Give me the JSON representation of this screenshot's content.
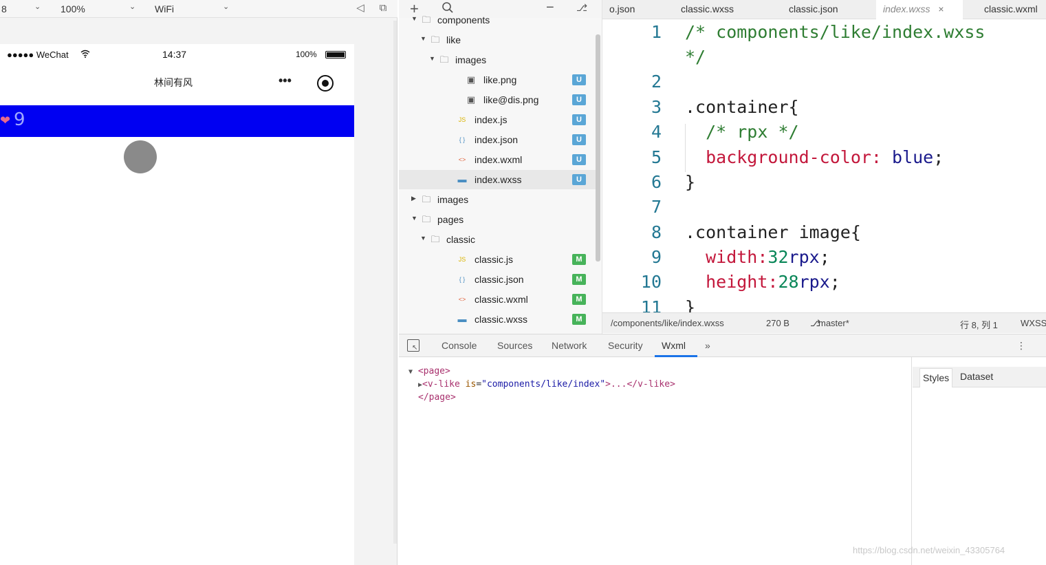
{
  "simulator": {
    "toolbar": {
      "device_value": "8",
      "zoom_value": "100%",
      "network_value": "WiFi"
    },
    "statusbar": {
      "signal": "●●●●● WeChat",
      "time": "14:37",
      "battery_percent": "100%"
    },
    "navbar": {
      "title": "林间有风",
      "more_icon": "•••",
      "record_icon": "◉"
    },
    "like_component": {
      "heart": "❤",
      "count": "9",
      "bar_color": "#0000f2"
    }
  },
  "file_tree": {
    "rows": [
      {
        "label": "components",
        "type": "folder",
        "depth": 1,
        "expanded": true,
        "badge": ""
      },
      {
        "label": "like",
        "type": "folder",
        "depth": 2,
        "expanded": true,
        "badge": ""
      },
      {
        "label": "images",
        "type": "folder",
        "depth": 3,
        "expanded": true,
        "badge": ""
      },
      {
        "label": "like.png",
        "type": "image",
        "depth": 4,
        "badge": "U"
      },
      {
        "label": "like@dis.png",
        "type": "image",
        "depth": 4,
        "badge": "U"
      },
      {
        "label": "index.js",
        "type": "js",
        "depth": 3,
        "badge": "U"
      },
      {
        "label": "index.json",
        "type": "json",
        "depth": 3,
        "badge": "U"
      },
      {
        "label": "index.wxml",
        "type": "wxml",
        "depth": 3,
        "badge": "U"
      },
      {
        "label": "index.wxss",
        "type": "wxss",
        "depth": 3,
        "badge": "U",
        "active": true
      },
      {
        "label": "images",
        "type": "folder",
        "depth": 1,
        "expanded": false,
        "badge": ""
      },
      {
        "label": "pages",
        "type": "folder",
        "depth": 1,
        "expanded": true,
        "badge": ""
      },
      {
        "label": "classic",
        "type": "folder",
        "depth": 2,
        "expanded": true,
        "badge": ""
      },
      {
        "label": "classic.js",
        "type": "js",
        "depth": 3,
        "badge": "M"
      },
      {
        "label": "classic.json",
        "type": "json",
        "depth": 3,
        "badge": "M"
      },
      {
        "label": "classic.wxml",
        "type": "wxml",
        "depth": 3,
        "badge": "M"
      },
      {
        "label": "classic.wxss",
        "type": "wxss",
        "depth": 3,
        "badge": "M"
      }
    ],
    "badge_colors": {
      "U": "#5aa6d6",
      "M": "#47b35a"
    }
  },
  "editor": {
    "tabs": [
      {
        "label": "o.json",
        "active": false
      },
      {
        "label": "classic.wxss",
        "active": false
      },
      {
        "label": "classic.json",
        "active": false
      },
      {
        "label": "index.wxss",
        "active": true,
        "close": "×"
      },
      {
        "label": "classic.wxml",
        "active": false
      }
    ],
    "lines": [
      {
        "n": "1",
        "parts": [
          [
            "c-comment",
            "/* components/like/index.wxss"
          ]
        ]
      },
      {
        "n": "",
        "parts": [
          [
            "c-comment",
            "*/"
          ]
        ]
      },
      {
        "n": "2",
        "parts": []
      },
      {
        "n": "3",
        "parts": [
          [
            "c-sel",
            ".container{"
          ]
        ]
      },
      {
        "n": "4",
        "parts": [
          [
            "c-comment",
            "  /* rpx */"
          ]
        ]
      },
      {
        "n": "5",
        "parts": [
          [
            "c-prop",
            "  background-color: "
          ],
          [
            "c-val",
            "blue"
          ],
          [
            "c-sel",
            ";"
          ]
        ]
      },
      {
        "n": "6",
        "parts": [
          [
            "c-sel",
            "}"
          ]
        ]
      },
      {
        "n": "7",
        "parts": []
      },
      {
        "n": "8",
        "parts": [
          [
            "c-sel",
            ".container image{"
          ]
        ]
      },
      {
        "n": "9",
        "parts": [
          [
            "c-prop",
            "  width:"
          ],
          [
            "c-num",
            "32"
          ],
          [
            "c-unit",
            "rpx"
          ],
          [
            "c-sel",
            ";"
          ]
        ]
      },
      {
        "n": "10",
        "parts": [
          [
            "c-prop",
            "  height:"
          ],
          [
            "c-num",
            "28"
          ],
          [
            "c-unit",
            "rpx"
          ],
          [
            "c-sel",
            ";"
          ]
        ]
      },
      {
        "n": "11",
        "parts": [
          [
            "c-sel",
            "}"
          ]
        ]
      }
    ],
    "status": {
      "path": "/components/like/index.wxss",
      "size": "270 B",
      "branch": "master*",
      "cursor": "行 8, 列 1",
      "lang": "WXSS"
    }
  },
  "debugger": {
    "tabs": [
      "Console",
      "Sources",
      "Network",
      "Security",
      "Wxml",
      "»"
    ],
    "active_tab": "Wxml",
    "xml": {
      "open_page": "<page>",
      "vlike_open": "<v-like",
      "attr_name": "is",
      "attr_value": "\"components/like/index\"",
      "vlike_rest": ">...</v-like>",
      "close_page": "</page>"
    },
    "styles_tabs": [
      "Styles",
      "Dataset"
    ]
  },
  "watermark": "https://blog.csdn.net/weixin_43305764"
}
